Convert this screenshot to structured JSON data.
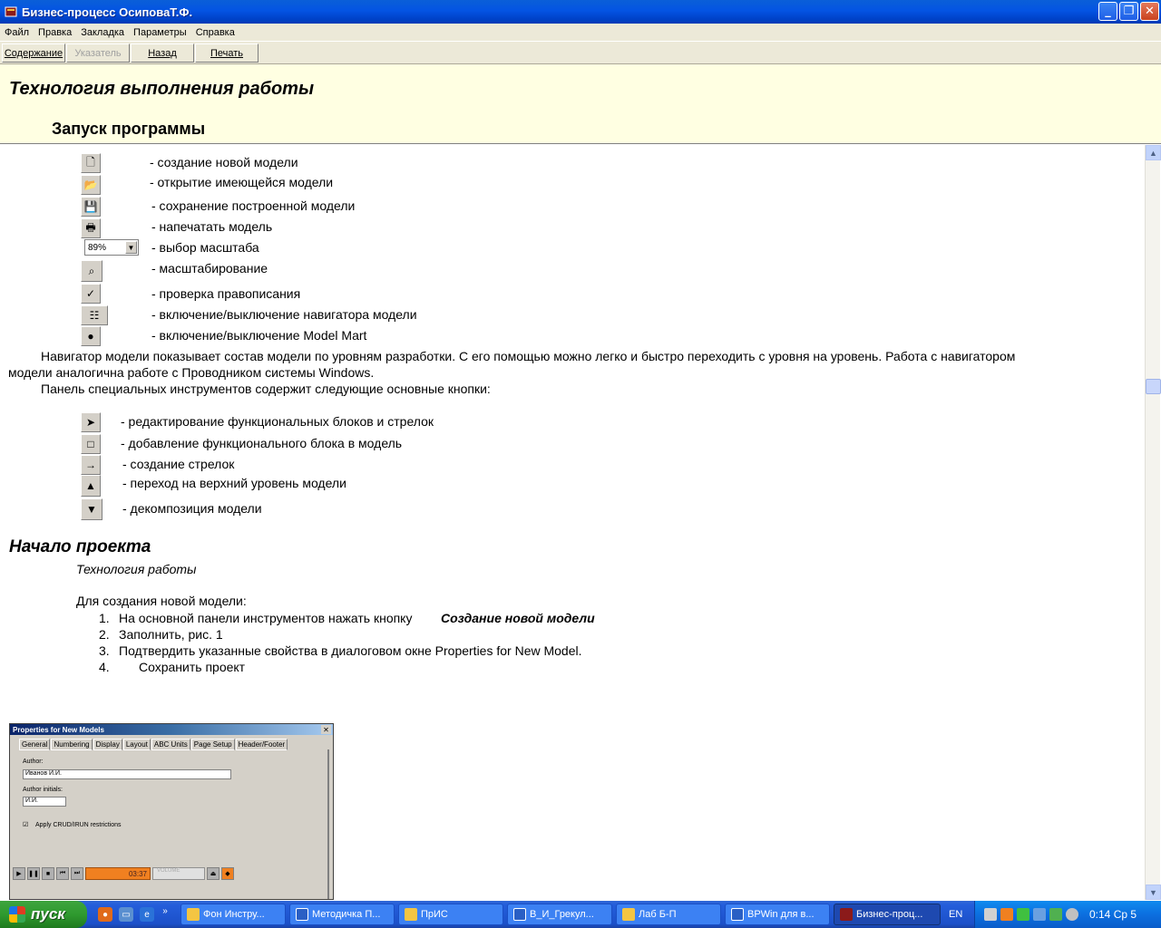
{
  "window": {
    "title": "Бизнес-процесс ОсиповаТ.Ф."
  },
  "menu": [
    "Файл",
    "Правка",
    "Закладка",
    "Параметры",
    "Справка"
  ],
  "toolbar": {
    "contents": "Содержание",
    "index": "Указатель",
    "back": "Назад",
    "print": "Печать"
  },
  "header": {
    "title": "Технология выполнения работы",
    "subtitle": "Запуск программы"
  },
  "main_toolbar_items": [
    {
      "icon": "new-document-icon",
      "text": "- создание новой модели"
    },
    {
      "icon": "open-folder-icon",
      "text": "- открытие имеющейся модели"
    },
    {
      "icon": "save-disk-icon",
      "text": "- сохранение построенной модели"
    },
    {
      "icon": "printer-icon",
      "text": "- напечатать модель"
    },
    {
      "icon": "zoom-select",
      "text": "- выбор масштаба",
      "value": "89%"
    },
    {
      "icon": "zoom-icon",
      "text": "- масштабирование"
    },
    {
      "icon": "spellcheck-icon",
      "text": "- проверка правописания"
    },
    {
      "icon": "navigator-icon",
      "text": "- включение/выключение навигатора модели"
    },
    {
      "icon": "model-mart-icon",
      "text": "- включение/выключение Model Mart"
    }
  ],
  "paragraphs": {
    "navigator_1": "Навигатор модели показывает состав модели по уровням разработки. С его помощью можно легко и быстро переходить с уровня на уровень. Работа с навигатором",
    "navigator_2": "модели аналогична работе с Проводником системы Windows.",
    "tools_intro": "Панель специальных инструментов содержит следующие основные кнопки:"
  },
  "special_tools": [
    {
      "icon": "pointer-arrow-icon",
      "text": "- редактирование функциональных блоков и стрелок"
    },
    {
      "icon": "box-icon",
      "text": "- добавление функционального блока в модель"
    },
    {
      "icon": "arrow-right-icon",
      "text": "- создание стрелок"
    },
    {
      "icon": "triangle-up-icon",
      "text": "- переход на верхний уровень модели"
    },
    {
      "icon": "triangle-down-icon",
      "text": "- декомпозиция модели"
    }
  ],
  "project": {
    "title": "Начало проекта",
    "subtitle": "Технология работы",
    "intro": "Для создания новой модели:",
    "step1_num": "1.",
    "step1_text": "На основной панели инструментов нажать кнопку",
    "step1_em": "Создание новой модели",
    "step2_num": "2.",
    "step2_text": "Заполнить, рис. 1",
    "step3_num": "3.",
    "step3_text": "Подтвердить указанные свойства в диалоговом окне Properties for New Model.",
    "step4_num": "4.",
    "step4_text": "Сохранить проект"
  },
  "dialog": {
    "title": "Properties for New Models",
    "tabs": [
      "General",
      "Numbering",
      "Display",
      "Layout",
      "ABC Units",
      "Page Setup",
      "Header/Footer"
    ],
    "author_label": "Author:",
    "author_value": "Иванов И.И.",
    "initials_label": "Author initials:",
    "initials_value": "И.И.",
    "checkbox_label": "Apply CRUD/IRUN restrictions",
    "media_time": "03:37",
    "media_volume": "VOLUME"
  },
  "taskbar": {
    "start": "пуск",
    "tasks": [
      "Фон Инстру...",
      "Методичка П...",
      "ПрИС",
      "В_И_Грекул...",
      "Лаб Б-П",
      "BPWin для в...",
      "Бизнес-проц..."
    ],
    "lang": "EN",
    "clock": "0:14 Ср 5"
  },
  "colors": {
    "header_bg": "#ffffe2",
    "titlebar": "#0454e3",
    "taskbar": "#245edb",
    "start": "#2f9a2f"
  }
}
